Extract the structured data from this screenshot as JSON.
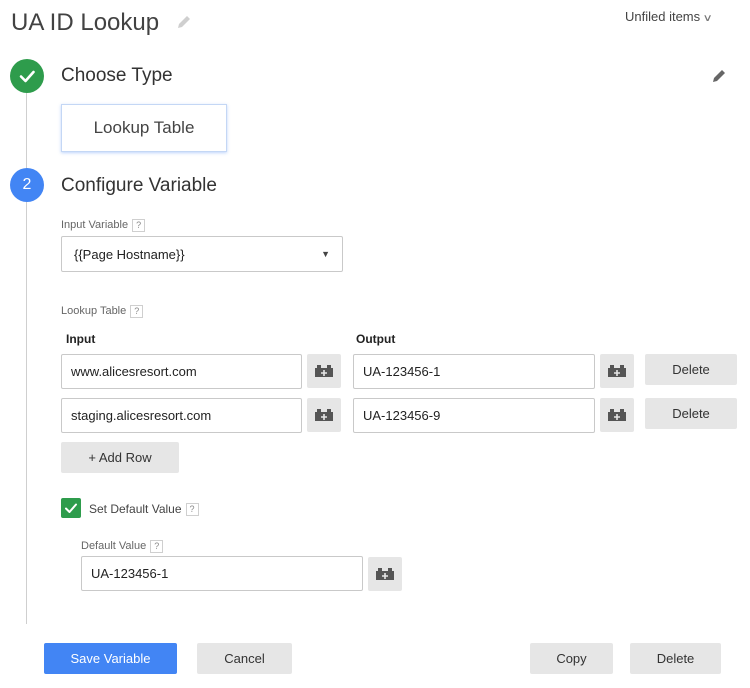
{
  "header": {
    "title": "UA ID Lookup",
    "folder_label": "Unfiled items"
  },
  "step1": {
    "title": "Choose Type",
    "selected_type": "Lookup Table"
  },
  "step2": {
    "number": "2",
    "title": "Configure Variable",
    "input_variable_label": "Input Variable",
    "input_variable_value": "{{Page Hostname}}",
    "lookup_table_label": "Lookup Table",
    "columns": {
      "input": "Input",
      "output": "Output"
    },
    "rows": [
      {
        "input": "www.alicesresort.com",
        "output": "UA-123456-1",
        "delete_label": "Delete"
      },
      {
        "input": "staging.alicesresort.com",
        "output": "UA-123456-9",
        "delete_label": "Delete"
      }
    ],
    "add_row_label": "+ Add Row",
    "set_default_label": "Set Default Value",
    "set_default_checked": true,
    "default_value_label": "Default Value",
    "default_value": "UA-123456-1",
    "help_glyph": "?"
  },
  "footer": {
    "save_label": "Save Variable",
    "cancel_label": "Cancel",
    "copy_label": "Copy",
    "delete_label": "Delete"
  },
  "colors": {
    "accent_blue": "#4285f4",
    "success_green": "#2e9c4c",
    "button_grey": "#e6e6e6"
  },
  "icons": {
    "title_edit": "pencil-icon",
    "step_done": "checkmark-icon",
    "step_edit": "pencil-icon",
    "variable_picker": "variable-brick-icon",
    "dropdown": "caret-down-icon",
    "folder_menu": "chevron-down-icon"
  }
}
